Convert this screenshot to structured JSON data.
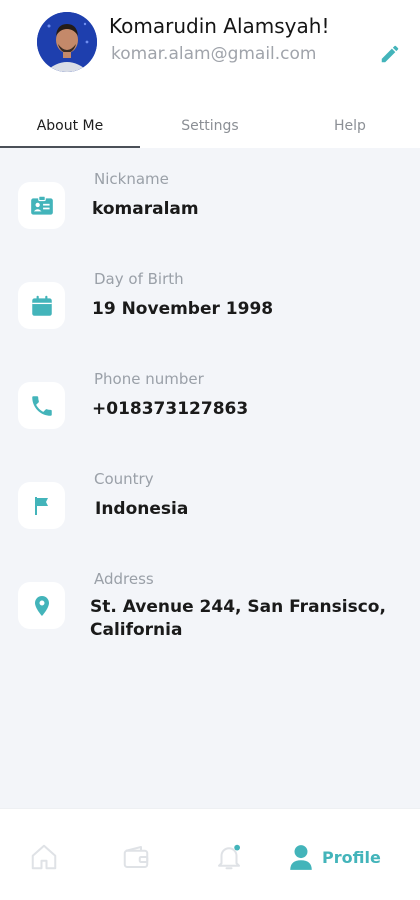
{
  "profile": {
    "name": "Komarudin Alamsyah!",
    "email": "komar.alam@gmail.com"
  },
  "tabs": [
    {
      "label": "About Me",
      "active": true
    },
    {
      "label": "Settings",
      "active": false
    },
    {
      "label": "Help",
      "active": false
    }
  ],
  "fields": [
    {
      "label": "Nickname",
      "value": "komaralam",
      "icon": "id-card-icon"
    },
    {
      "label": "Day of Birth",
      "value": "19 November 1998",
      "icon": "calendar-icon"
    },
    {
      "label": "Phone number",
      "value": "+018373127863",
      "icon": "phone-icon"
    },
    {
      "label": "Country",
      "value": "Indonesia",
      "icon": "flag-icon"
    },
    {
      "label": "Address",
      "value": "St. Avenue 244, San Fransisco, California",
      "icon": "location-pin-icon"
    }
  ],
  "bottom_nav": {
    "items": [
      {
        "icon": "home-icon",
        "active": false
      },
      {
        "icon": "wallet-icon",
        "active": false
      },
      {
        "icon": "bell-icon",
        "active": false
      },
      {
        "icon": "profile-icon",
        "label": "Profile",
        "active": true
      }
    ]
  },
  "colors": {
    "accent": "#43b4ba",
    "background": "#f3f5f9",
    "muted_text": "#9aa0a8",
    "inactive_icon": "#dfe2e6"
  }
}
